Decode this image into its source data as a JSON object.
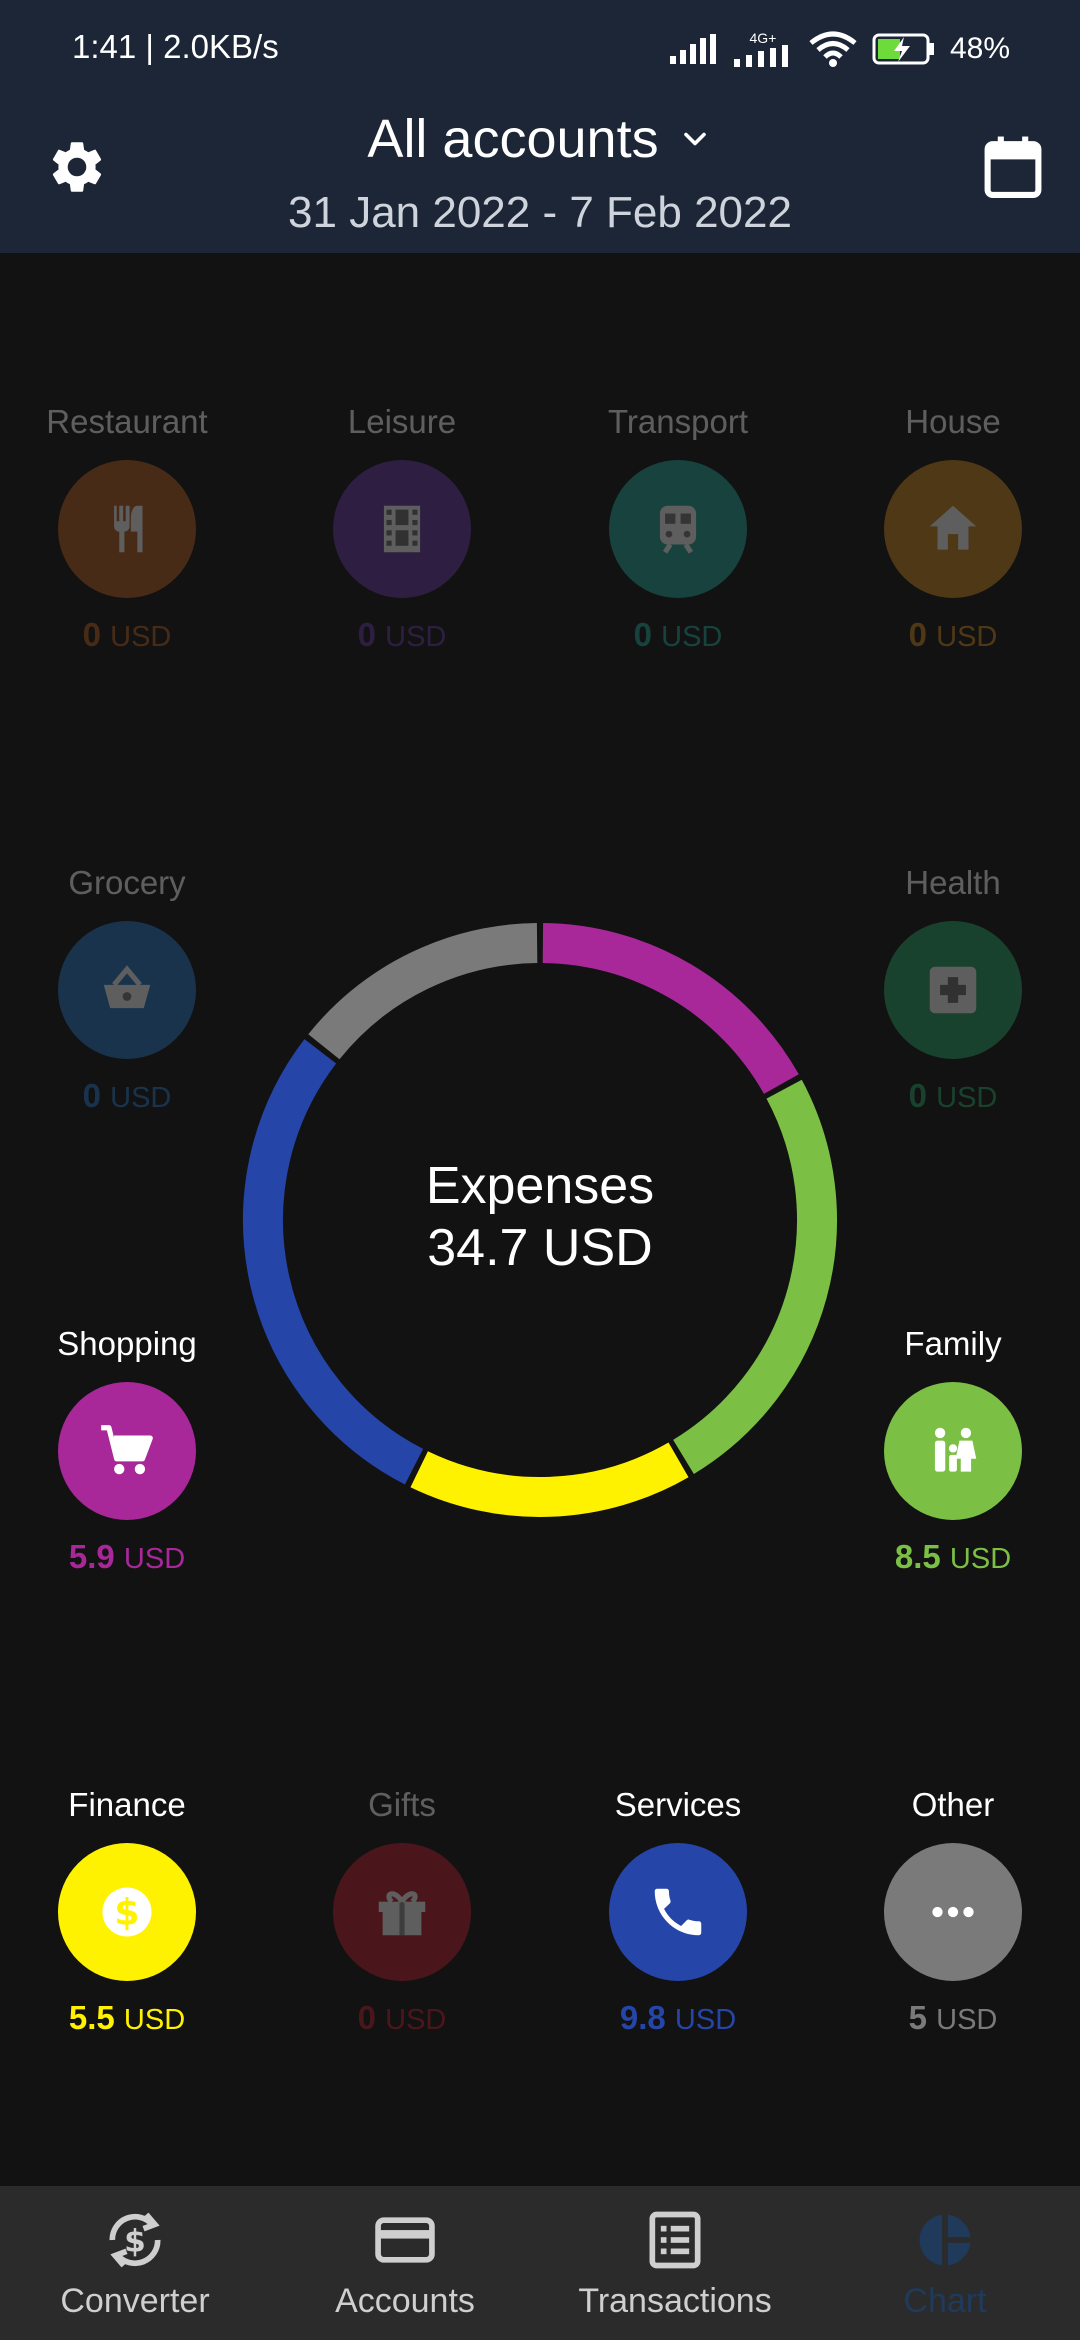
{
  "status_bar": {
    "time": "1:41 | 2.0KB/s",
    "network": "4G+",
    "battery": "48%"
  },
  "header": {
    "title": "All accounts",
    "date_range": "31 Jan 2022 - 7 Feb 2022",
    "settings_icon": "gear-icon",
    "calendar_icon": "calendar-icon"
  },
  "categories": [
    {
      "name": "Restaurant",
      "amount": "0",
      "currency": "USD",
      "color": "#b8621f",
      "icon": "fork-knife-icon",
      "active": false
    },
    {
      "name": "Leisure",
      "amount": "0",
      "currency": "USD",
      "color": "#6a3aa8",
      "icon": "film-icon",
      "active": false
    },
    {
      "name": "Transport",
      "amount": "0",
      "currency": "USD",
      "color": "#22a79a",
      "icon": "train-icon",
      "active": false
    },
    {
      "name": "House",
      "amount": "0",
      "currency": "USD",
      "color": "#d18a1c",
      "icon": "house-icon",
      "active": false
    },
    {
      "name": "Grocery",
      "amount": "0",
      "currency": "USD",
      "color": "#2a79c6",
      "icon": "basket-icon",
      "active": false
    },
    {
      "name": "Health",
      "amount": "0",
      "currency": "USD",
      "color": "#2aa86a",
      "icon": "medical-cross-icon",
      "active": false
    },
    {
      "name": "Shopping",
      "amount": "5.9",
      "currency": "USD",
      "color": "#a8289a",
      "icon": "cart-icon",
      "active": true
    },
    {
      "name": "Family",
      "amount": "8.5",
      "currency": "USD",
      "color": "#7bbf45",
      "icon": "family-icon",
      "active": true
    },
    {
      "name": "Finance",
      "amount": "5.5",
      "currency": "USD",
      "color": "#fff200",
      "icon": "dollar-icon",
      "active": true
    },
    {
      "name": "Gifts",
      "amount": "0",
      "currency": "USD",
      "color": "#c4202e",
      "icon": "gift-icon",
      "active": false
    },
    {
      "name": "Services",
      "amount": "9.8",
      "currency": "USD",
      "color": "#2545a8",
      "icon": "phone-icon",
      "active": true
    },
    {
      "name": "Other",
      "amount": "5",
      "currency": "USD",
      "color": "#7a7a7a",
      "icon": "more-dots-icon",
      "active": true
    }
  ],
  "chart_data": {
    "type": "pie",
    "title": "Expenses",
    "total": "34.7 USD",
    "series": [
      {
        "name": "Shopping",
        "value": 5.9,
        "color": "#a8289a"
      },
      {
        "name": "Family",
        "value": 8.5,
        "color": "#7bbf45"
      },
      {
        "name": "Finance",
        "value": 5.5,
        "color": "#fff200"
      },
      {
        "name": "Services",
        "value": 9.8,
        "color": "#2545a8"
      },
      {
        "name": "Other",
        "value": 5,
        "color": "#7a7a7a"
      }
    ]
  },
  "donut_center": {
    "label": "Expenses",
    "total": "34.7 USD"
  },
  "bottom_nav": [
    {
      "label": "Converter",
      "icon": "currency-exchange-icon",
      "active": false
    },
    {
      "label": "Accounts",
      "icon": "credit-card-icon",
      "active": false
    },
    {
      "label": "Transactions",
      "icon": "receipt-list-icon",
      "active": false
    },
    {
      "label": "Chart",
      "icon": "pie-chart-icon",
      "active": true
    }
  ]
}
